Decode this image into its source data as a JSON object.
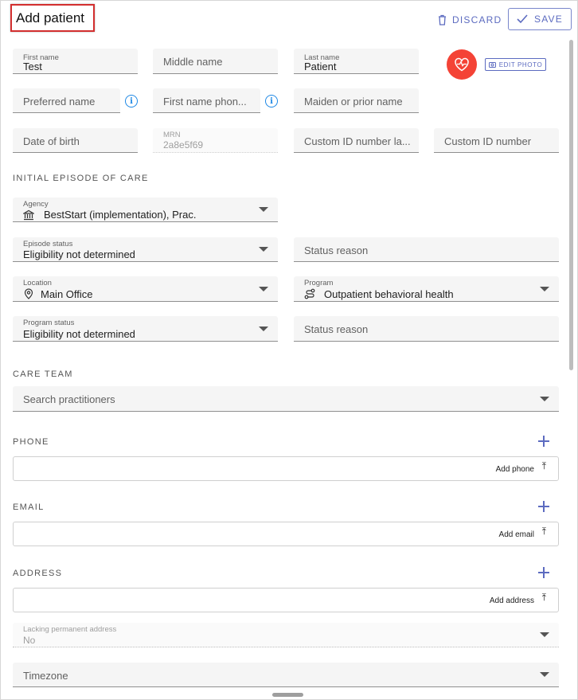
{
  "header": {
    "title": "Add patient",
    "discard_label": "DISCARD",
    "save_label": "SAVE"
  },
  "names": {
    "first_name": {
      "label": "First name",
      "value": "Test"
    },
    "middle_name": {
      "placeholder": "Middle name"
    },
    "last_name": {
      "label": "Last name",
      "value": "Patient"
    },
    "preferred_name": {
      "placeholder": "Preferred name"
    },
    "first_name_phonetic": {
      "placeholder": "First name phon..."
    },
    "maiden_name": {
      "placeholder": "Maiden or prior name"
    },
    "dob": {
      "placeholder": "Date of birth"
    },
    "mrn": {
      "label": "MRN",
      "value": "2a8e5f69"
    },
    "custom_id_label": {
      "placeholder": "Custom ID number la..."
    },
    "custom_id_number": {
      "placeholder": "Custom ID number"
    }
  },
  "photo": {
    "edit_label": "EDIT PHOTO"
  },
  "episode": {
    "section_title": "INITIAL EPISODE OF CARE",
    "agency": {
      "label": "Agency",
      "value": "BestStart (implementation), Prac."
    },
    "episode_status": {
      "label": "Episode status",
      "value": "Eligibility not determined"
    },
    "status_reason_1": {
      "placeholder": "Status reason"
    },
    "location": {
      "label": "Location",
      "value": "Main Office"
    },
    "program": {
      "label": "Program",
      "value": "Outpatient behavioral health"
    },
    "program_status": {
      "label": "Program status",
      "value": "Eligibility not determined"
    },
    "status_reason_2": {
      "placeholder": "Status reason"
    }
  },
  "care_team": {
    "section_title": "CARE TEAM",
    "search_placeholder": "Search practitioners"
  },
  "phone": {
    "section_title": "PHONE",
    "add_label": "Add phone"
  },
  "email": {
    "section_title": "EMAIL",
    "add_label": "Add email"
  },
  "address": {
    "section_title": "ADDRESS",
    "add_label": "Add address",
    "lacking_label": "Lacking permanent address",
    "lacking_value": "No"
  },
  "timezone": {
    "placeholder": "Timezone"
  },
  "colors": {
    "accent": "#5c6bc0",
    "avatar": "#f44336",
    "info": "#1e88e5",
    "title_outline": "#d32f2f"
  },
  "icons": [
    "trash-icon",
    "check-icon",
    "info-icon",
    "heart-pulse-icon",
    "camera-icon",
    "bank-icon",
    "location-pin-icon",
    "route-icon",
    "chevron-down-icon",
    "plus-icon",
    "sort-arrow-icon"
  ]
}
